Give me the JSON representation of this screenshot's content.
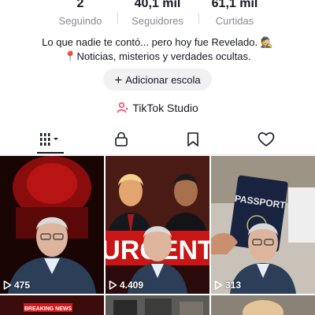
{
  "stats": [
    {
      "value": "2",
      "label": "Seguindo"
    },
    {
      "value": "40,1 mil",
      "label": "Seguidores"
    },
    {
      "value": "61,1 mil",
      "label": "Curtidas"
    }
  ],
  "bio": {
    "line1": "Lo que nadie te contó... pero hoy fue Revelado. 🕵",
    "line2": "📍Noticias, misterios y verdades ocultas."
  },
  "add_school": {
    "label": "Adicionar escola",
    "icon": "plus-icon"
  },
  "studio": {
    "label": "TikTok Studio",
    "icon": "person-sparkle-icon"
  },
  "tabs": [
    {
      "name": "videos",
      "icon": "grid-icon",
      "active": true
    },
    {
      "name": "private",
      "icon": "lock-icon"
    },
    {
      "name": "favorites",
      "icon": "bookmark-icon"
    },
    {
      "name": "liked",
      "icon": "heart-icon"
    }
  ],
  "videos": [
    {
      "views": "475"
    },
    {
      "views": "4.409",
      "overlay_text": "URGENT"
    },
    {
      "views": "313",
      "overlay_text": "PASSPORT"
    },
    {
      "overlay_text": "BREAKING NEWS"
    },
    {},
    {}
  ],
  "colors": {
    "text": "#161823",
    "muted": "#8a8b91",
    "pill_bg": "#f1f1f2",
    "urgent_red": "#d21a1a"
  }
}
